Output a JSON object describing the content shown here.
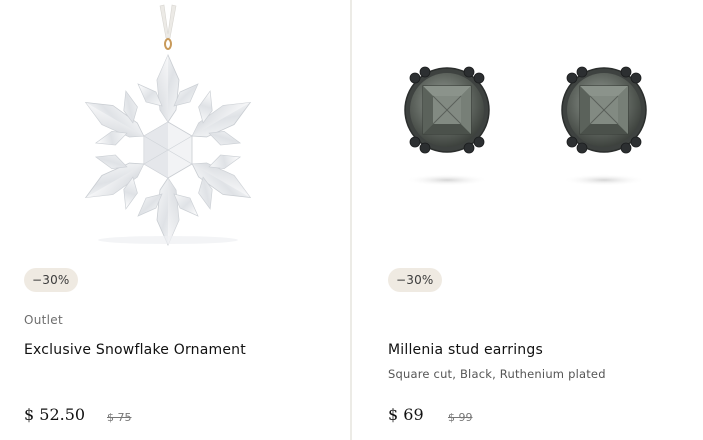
{
  "products": [
    {
      "badge": "−30%",
      "category": "Outlet",
      "title": "Exclusive Snowflake Ornament",
      "price": "$ 52.50",
      "old_price": "$ 75",
      "image_icon": "snowflake-ornament-image"
    },
    {
      "badge": "−30%",
      "title": "Millenia stud earrings",
      "subtitle": "Square cut, Black, Ruthenium plated",
      "price": "$ 69",
      "old_price": "$ 99",
      "image_icon": "stud-earrings-image"
    }
  ],
  "colors": {
    "badge_bg": "#efeae2",
    "divider": "#ecebe6",
    "crystal": "#e9ebee",
    "gem_dark": "#4a4f4a",
    "metal": "#3a3d40"
  }
}
